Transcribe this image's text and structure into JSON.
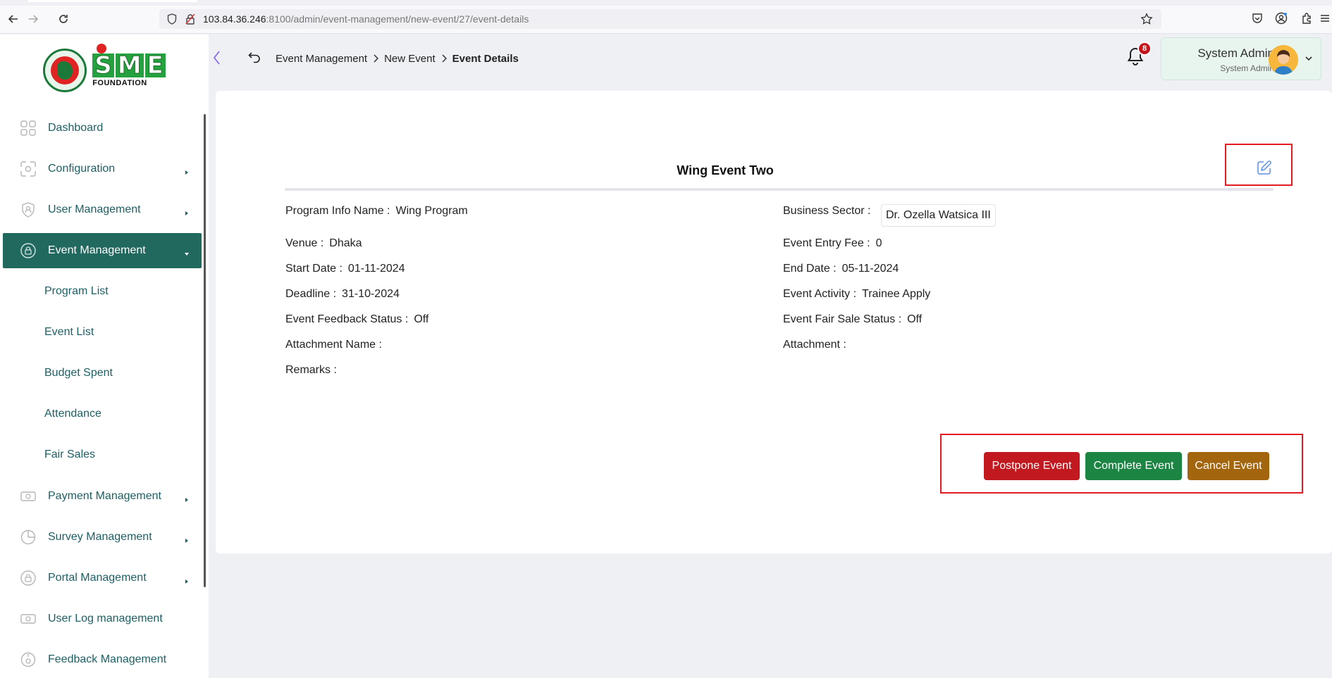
{
  "browser": {
    "url_host": "103.84.36.246",
    "url_rest": ":8100/admin/event-management/new-event/27/event-details"
  },
  "brand": {
    "logo_letters": [
      "S",
      "M",
      "E"
    ],
    "logo_subtitle": "FOUNDATION"
  },
  "header": {
    "breadcrumb": [
      "Event Management",
      "New Event",
      "Event Details"
    ],
    "notification_count": "8",
    "user_name": "System Admin",
    "user_role": "System Admin"
  },
  "sidebar": {
    "items": [
      {
        "label": "Dashboard",
        "icon": "grid-icon",
        "has_arrow": false
      },
      {
        "label": "Configuration",
        "icon": "configuration-icon",
        "has_arrow": true
      },
      {
        "label": "User Management",
        "icon": "shield-user-icon",
        "has_arrow": true
      },
      {
        "label": "Event Management",
        "icon": "lock-circle-icon",
        "has_arrow": true,
        "active": true
      },
      {
        "label": "Payment Management",
        "icon": "money-icon",
        "has_arrow": true
      },
      {
        "label": "Survey Management",
        "icon": "pie-chart-icon",
        "has_arrow": true
      },
      {
        "label": "Portal Management",
        "icon": "lock-circle-icon",
        "has_arrow": true
      },
      {
        "label": "User Log management",
        "icon": "money-icon",
        "has_arrow": false
      },
      {
        "label": "Feedback Management",
        "icon": "feedback-icon",
        "has_arrow": false
      }
    ],
    "sub_items": [
      "Program List",
      "Event List",
      "Budget Spent",
      "Attendance",
      "Fair Sales"
    ]
  },
  "event": {
    "title": "Wing Event Two",
    "program_info_name_label": "Program Info Name :",
    "program_info_name": "Wing Program",
    "business_sector_label": "Business Sector :",
    "business_sector": "Dr. Ozella Watsica III",
    "venue_label": "Venue :",
    "venue": "Dhaka",
    "entry_fee_label": "Event Entry Fee :",
    "entry_fee": "0",
    "start_date_label": "Start Date :",
    "start_date": "01-11-2024",
    "end_date_label": "End Date :",
    "end_date": "05-11-2024",
    "deadline_label": "Deadline :",
    "deadline": "31-10-2024",
    "activity_label": "Event Activity :",
    "activity": "Trainee Apply",
    "feedback_status_label": "Event Feedback Status :",
    "feedback_status": "Off",
    "fair_sale_status_label": "Event Fair Sale Status :",
    "fair_sale_status": "Off",
    "attachment_name_label": "Attachment Name :",
    "attachment_label": "Attachment :",
    "remarks_label": "Remarks :"
  },
  "actions": {
    "postpone": "Postpone Event",
    "complete": "Complete Event",
    "cancel": "Cancel Event"
  },
  "colors": {
    "sidebar_active": "#21685f",
    "sidebar_text": "#1d5f63",
    "postpone": "#c2181f",
    "complete": "#1c8543",
    "cancel": "#a3650d",
    "highlight": "#e21a22"
  }
}
